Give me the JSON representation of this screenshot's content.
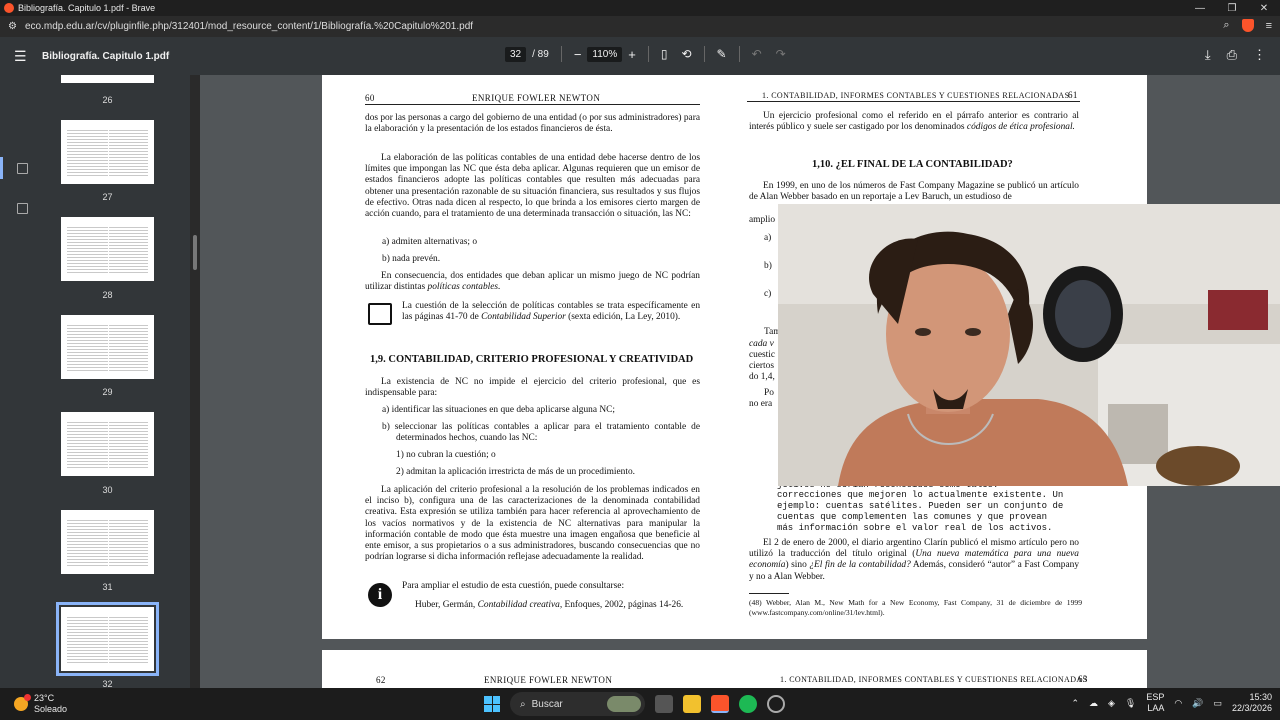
{
  "window": {
    "title": "Bibliografía. Capitulo 1.pdf - Brave",
    "url": "eco.mdp.edu.ar/cv/pluginfile.php/312401/mod_resource_content/1/Bibliografía.%20Capitulo%201.pdf",
    "minimize": "—",
    "restore": "❐",
    "close": "✕"
  },
  "toolbar": {
    "file_title": "Bibliografía. Capitulo 1.pdf",
    "page_current": "32",
    "page_total": "/ 89",
    "zoom": "110%",
    "minus": "−",
    "plus": "+"
  },
  "thumbnails": {
    "pages": [
      "26",
      "27",
      "28",
      "29",
      "30",
      "31",
      "32"
    ]
  },
  "left_page": {
    "header_num": "60",
    "header_title": "ENRIQUE FOWLER NEWTON",
    "p1": "dos por las personas a cargo del gobierno de una entidad (o por sus administradores) para la elaboración y la presentación de los estados financieros de ésta.",
    "p2": "La elaboración de las políticas contables de una entidad debe hacerse dentro de los límites que impongan las NC que ésta deba aplicar. Algunas requieren que un emisor de estados financieros adopte las políticas contables que resulten más adecuadas para obtener una presentación razonable de su situación financiera, sus resultados y sus flujos de efectivo. Otras nada dicen al respecto, lo que brinda a los emisores cierto margen de acción cuando, para el tratamiento de una determinada transacción o situación, las NC:",
    "a": "a) admiten alternativas; o",
    "b": "b) nada prevén.",
    "p3": "En consecuencia, dos entidades que deban aplicar un mismo juego de NC podrían utilizar distintas",
    "p3_ital": "políticas contables.",
    "note": "La cuestión de la selección de políticas contables se trata específicamente en las páginas 41-70 de",
    "note_ital": "Contabilidad Superior",
    "note_end": "(sexta edición, La Ley, 2010).",
    "heading": "1,9. CONTABILIDAD, CRITERIO PROFESIONAL Y CREATIVIDAD",
    "p4": "La existencia de NC no impide el ejercicio del criterio profesional, que es indispensable para:",
    "la": "a) identificar las situaciones en que deba aplicarse alguna NC;",
    "lb": "b) seleccionar las políticas contables a aplicar para el tratamiento contable de determinados hechos, cuando las NC:",
    "l1": "1) no cubran la cuestión; o",
    "l2": "2) admitan la aplicación irrestricta de más de un procedimiento.",
    "p5": "La aplicación del criterio profesional a la resolución de los problemas indicados en el inciso b), configura una de las caracterizaciones de la denominada contabilidad creativa. Esta expresión se utiliza también para hacer referencia al aprovechamiento de los vacíos normativos y de la existencia de NC alternativas para manipular la información contable de modo que ésta muestre una imagen engañosa que beneficie al ente emisor, a sus propietarios o a sus administradores, buscando consecuencias que no podrían lograrse si dicha información reflejase adecuadamente la realidad.",
    "info": "Para ampliar el estudio de esta cuestión, puede consultarse:",
    "ref": "Huber, Germán,",
    "ref_ital": "Contabilidad creativa,",
    "ref_end": "Enfoques, 2002, páginas 14-26."
  },
  "right_page": {
    "header_title": "1. CONTABILIDAD, INFORMES CONTABLES Y CUESTIONES RELACIONADAS",
    "header_num": "61",
    "p1": "Un ejercicio profesional como el referido en el párrafo anterior es contrario al interés público y suele ser castigado por los denominados",
    "p1_ital": "códigos de ética profesional.",
    "heading": "1,10. ¿EL FINAL DE LA CONTABILIDAD?",
    "p2": "En 1999, en uno de los números de Fast Company Magazine se publicó un artículo de Alan Webber basado en un reportaje a Lev Baruch, un estudioso de",
    "p2b": "amplio",
    "la": "a)",
    "lb": "b)",
    "lc": "c)",
    "f1": "Tam",
    "f2": "cada v",
    "f3": "cuestic",
    "f4": "ciertos",
    "f5": "do 1,4,",
    "f6": "Po",
    "f7": "no era",
    "mono1": "jetivos no serían reconocidos como tales.",
    "mono2": "correcciones que mejoren lo actualmente existente. Un",
    "mono3": "ejemplo: cuentas satélites. Pueden ser un conjunto de",
    "mono4": "cuentas que complementen las comunes y que provean",
    "mono5": "más información sobre el valor real de los activos.",
    "p3": "El 2 de enero de 2000, el diario argentino Clarín publicó el mismo artículo pero no utilizó la traducción del título original (",
    "p3_ital": "Una nueva matemática para una nueva economía",
    "p3_mid": ") sino",
    "p3_ital2": "¿El fin de la contabilidad?",
    "p3_end": "Además, consideró “autor” a Fast Company y no a Alan Webber.",
    "footnote": "(48) Webber, Alan M., New Math for a New Economy, Fast Company, 31 de diciembre de 1999 (www.fastcompany.com/online/31/lev.html)."
  },
  "next_left": {
    "num": "62",
    "title": "ENRIQUE FOWLER NEWTON"
  },
  "next_right": {
    "title": "1. CONTABILIDAD, INFORMES CONTABLES Y CUESTIONES RELACIONADAS",
    "num": "63"
  },
  "taskbar": {
    "temp": "23°C",
    "weather": "Soleado",
    "search": "Buscar",
    "lang1": "ESP",
    "lang2": "LAA",
    "time": "15:30",
    "date": "22/3/2026"
  },
  "colors": {
    "accent": "#8ab4f8",
    "brave": "#fb542b"
  }
}
